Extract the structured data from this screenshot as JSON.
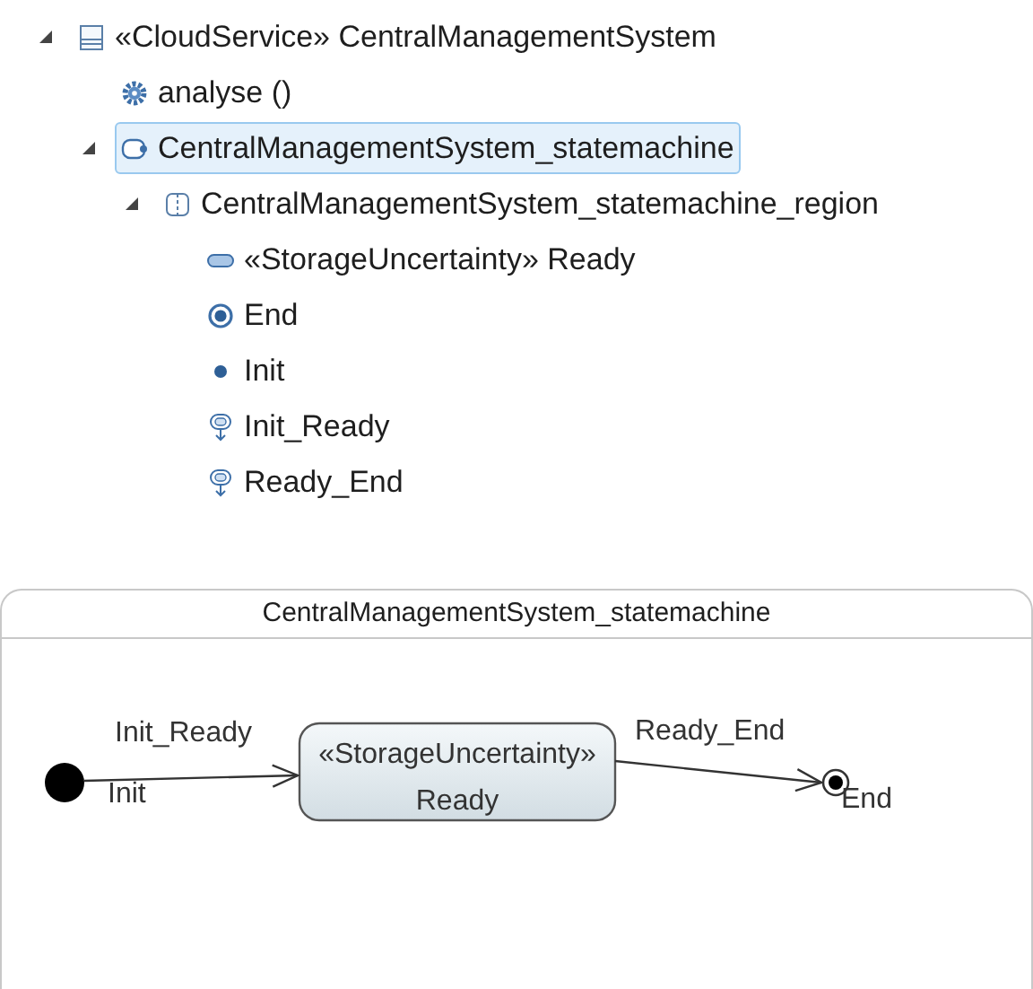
{
  "tree": [
    {
      "kind": "class",
      "label": "«CloudService» CentralManagementSystem",
      "expanded": true,
      "selected": false,
      "children": [
        {
          "kind": "operation",
          "label": "analyse ()",
          "selected": false
        },
        {
          "kind": "statemachine",
          "label": "CentralManagementSystem_statemachine",
          "expanded": true,
          "selected": true,
          "children": [
            {
              "kind": "region",
              "label": "CentralManagementSystem_statemachine_region",
              "expanded": true,
              "selected": false,
              "children": [
                {
                  "kind": "state",
                  "label": "«StorageUncertainty» Ready",
                  "selected": false
                },
                {
                  "kind": "final",
                  "label": "End",
                  "selected": false
                },
                {
                  "kind": "initial",
                  "label": "Init",
                  "selected": false
                },
                {
                  "kind": "transition",
                  "label": "Init_Ready",
                  "selected": false
                },
                {
                  "kind": "transition",
                  "label": "Ready_End",
                  "selected": false
                }
              ]
            }
          ]
        }
      ]
    }
  ],
  "diagram": {
    "title": "CentralManagementSystem_statemachine",
    "nodes": [
      {
        "kind": "initial",
        "label": "Init"
      },
      {
        "kind": "state",
        "stereotype": "«StorageUncertainty»",
        "label": "Ready"
      },
      {
        "kind": "final",
        "label": "End"
      }
    ],
    "transitions": [
      {
        "label": "Init_Ready"
      },
      {
        "label": "Ready_End"
      }
    ]
  }
}
